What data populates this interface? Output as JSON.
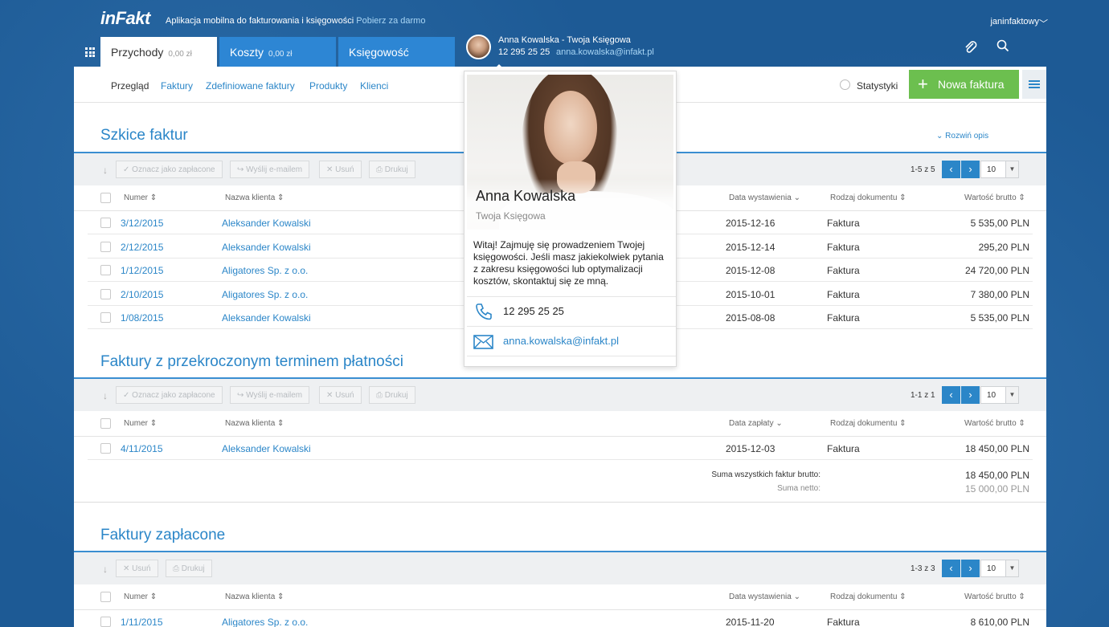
{
  "app": {
    "logo": "inFakt",
    "tagline": "Aplikacja mobilna do fakturowania i księgowości",
    "tagline_link": "Pobierz za darmo",
    "user": "janinfaktowy"
  },
  "tabs": [
    {
      "label": "Przychody",
      "amount": "0,00 zł"
    },
    {
      "label": "Koszty",
      "amount": "0,00 zł"
    },
    {
      "label": "Księgowość"
    }
  ],
  "accountant": {
    "header_name": "Anna Kowalska - Twoja Księgowa",
    "phone": "12 295 25 25",
    "email": "anna.kowalska@infakt.pl",
    "name": "Anna Kowalska",
    "role": "Twoja Księgowa",
    "description": "Witaj! Zajmuję się prowadzeniem Twojej księgowości. Jeśli masz jakiekolwiek pytania z zakresu księgowości lub optymalizacji kosztów, skontaktuj się ze mną."
  },
  "subnav": {
    "items": [
      "Przegląd",
      "Faktury",
      "Zdefiniowane faktury",
      "Produkty",
      "Klienci"
    ],
    "stats": "Statystyki",
    "new_invoice": "Nowa faktura"
  },
  "actions": {
    "mark_paid": "Oznacz jako zapłacone",
    "send_email": "Wyślij e-mailem",
    "delete": "Usuń",
    "print": "Drukuj"
  },
  "columns": {
    "number": "Numer",
    "client": "Nazwa klienta",
    "issue_date": "Data wystawienia",
    "pay_date": "Data zapłaty",
    "doc_type": "Rodzaj dokumentu",
    "gross": "Wartość brutto"
  },
  "drafts": {
    "title": "Szkice faktur",
    "expand": "Rozwiń opis",
    "pager": "1-5 z 5",
    "per_page": "10",
    "rows": [
      {
        "number": "3/12/2015",
        "client": "Aleksander Kowalski",
        "date": "2015-12-16",
        "type": "Faktura",
        "value": "5 535,00 PLN"
      },
      {
        "number": "2/12/2015",
        "client": "Aleksander Kowalski",
        "date": "2015-12-14",
        "type": "Faktura",
        "value": "295,20 PLN"
      },
      {
        "number": "1/12/2015",
        "client": "Aligatores Sp. z o.o.",
        "date": "2015-12-08",
        "type": "Faktura",
        "value": "24 720,00 PLN"
      },
      {
        "number": "2/10/2015",
        "client": "Aligatores Sp. z o.o.",
        "date": "2015-10-01",
        "type": "Faktura",
        "value": "7 380,00 PLN"
      },
      {
        "number": "1/08/2015",
        "client": "Aleksander Kowalski",
        "date": "2015-08-08",
        "type": "Faktura",
        "value": "5 535,00 PLN"
      }
    ]
  },
  "overdue": {
    "title": "Faktury z przekroczonym terminem płatności",
    "pager": "1-1 z 1",
    "per_page": "10",
    "rows": [
      {
        "number": "4/11/2015",
        "client": "Aleksander Kowalski",
        "date": "2015-12-03",
        "type": "Faktura",
        "value": "18 450,00 PLN"
      }
    ],
    "sum_gross_label": "Suma wszystkich faktur brutto:",
    "sum_gross": "18 450,00 PLN",
    "sum_net_label": "Suma netto:",
    "sum_net": "15 000,00 PLN"
  },
  "paid": {
    "title": "Faktury zapłacone",
    "pager": "1-3 z 3",
    "per_page": "10",
    "rows": [
      {
        "number": "1/11/2015",
        "client": "Aligatores Sp. z o.o.",
        "date": "2015-11-20",
        "type": "Faktura",
        "value": "8 610,00 PLN"
      }
    ]
  }
}
